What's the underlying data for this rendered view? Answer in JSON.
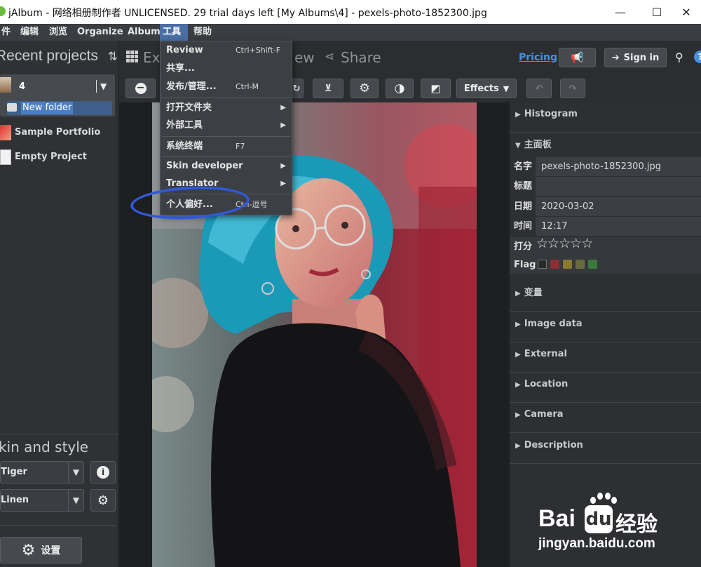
{
  "window": {
    "title": "jAlbum - 网络相册制作者 UNLICENSED. 29 trial days left [My Albums\\4] - pexels-photo-1852300.jpg",
    "minimize": "—",
    "maximize": "☐",
    "close": "✕"
  },
  "menubar": {
    "items": [
      "件",
      "编辑",
      "浏览",
      "Organize",
      "Album",
      "工具",
      "帮助"
    ]
  },
  "left": {
    "projects_title": "Recent projects",
    "sort_icon": "⇅",
    "selected_project": "4",
    "new_folder": "New folder",
    "projects": [
      "Sample Portfolio",
      "Empty Project"
    ],
    "skin_title": "kin and style",
    "skin": "Tiger",
    "style": "Linen",
    "settings_label": "设置"
  },
  "topnav": {
    "tabs": [
      "Ex",
      "ew",
      "Share"
    ],
    "pricing": "Pricing",
    "sign_in": "Sign in"
  },
  "toolbar": {
    "effects": "Effects"
  },
  "tools_menu": {
    "items": [
      {
        "label": "Review",
        "shortcut": "Ctrl+Shift-F",
        "submenu": false
      },
      {
        "label": "共享...",
        "shortcut": "",
        "submenu": false
      },
      {
        "label": "发布/管理...",
        "shortcut": "Ctrl-M",
        "submenu": false
      },
      {
        "label": "打开文件夹",
        "shortcut": "",
        "submenu": true
      },
      {
        "label": "外部工具",
        "shortcut": "",
        "submenu": true
      },
      {
        "label": "系统终端",
        "shortcut": "F7",
        "submenu": false
      },
      {
        "label": "Skin developer",
        "shortcut": "",
        "submenu": true
      },
      {
        "label": "Translator",
        "shortcut": "",
        "submenu": true
      },
      {
        "label": "个人偏好...",
        "shortcut": "Ctrl-逗号",
        "submenu": false
      }
    ]
  },
  "right": {
    "histogram": "Histogram",
    "main_panel": "主面板",
    "fields": [
      {
        "label": "名字",
        "value": "pexels-photo-1852300.jpg"
      },
      {
        "label": "标题",
        "value": ""
      },
      {
        "label": "日期",
        "value": "2020-03-02"
      },
      {
        "label": "时间",
        "value": "12:17"
      }
    ],
    "rating_label": "打分",
    "stars": "☆☆☆☆☆",
    "flag_label": "Flag",
    "flag_colors": [
      "#2a2a2a",
      "#8a3030",
      "#8a7a30",
      "#6a6a40",
      "#305a8a",
      "#3a7a3a"
    ],
    "sections": [
      "变量",
      "Image data",
      "External",
      "Location",
      "Camera",
      "Description"
    ]
  },
  "watermark": {
    "brand": "Bai",
    "brand_cn": "经验",
    "url": "jingyan.baidu.com"
  },
  "colors": {
    "accent": "#4a90e2",
    "highlight_circle": "#3158d6",
    "menu_active": "#4a6fa5"
  }
}
